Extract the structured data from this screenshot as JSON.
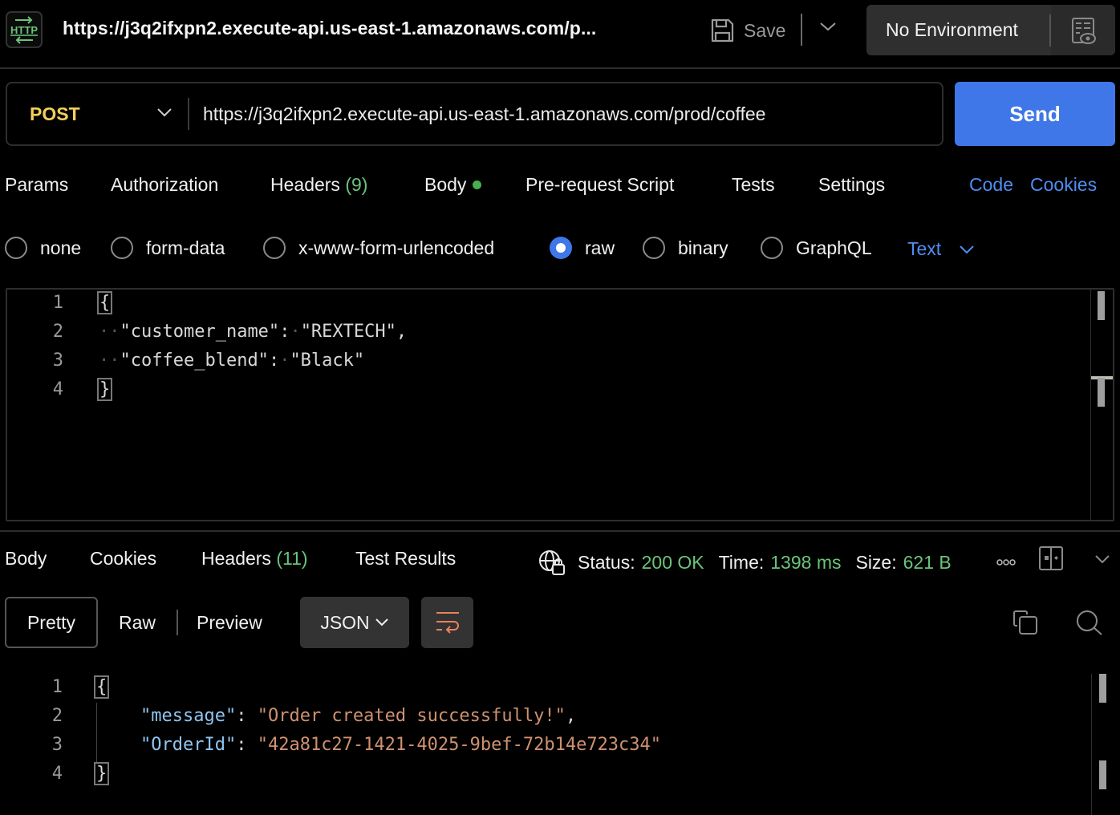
{
  "topbar": {
    "badge_label": "HTTP",
    "title": "https://j3q2ifxpn2.execute-api.us-east-1.amazonaws.com/p...",
    "save_label": "Save",
    "environment": "No Environment",
    "accent_green": "#6ac47a"
  },
  "request": {
    "method": "POST",
    "method_color": "#f2cf5c",
    "url": "https://j3q2ifxpn2.execute-api.us-east-1.amazonaws.com/prod/coffee",
    "send_label": "Send",
    "send_color": "#3f77e8"
  },
  "request_tabs": {
    "params": "Params",
    "authorization": "Authorization",
    "headers": "Headers",
    "headers_count": "(9)",
    "body": "Body",
    "pre_request": "Pre-request Script",
    "tests": "Tests",
    "settings": "Settings",
    "code": "Code",
    "cookies": "Cookies"
  },
  "body_types": {
    "options": [
      "none",
      "form-data",
      "x-www-form-urlencoded",
      "raw",
      "binary",
      "GraphQL"
    ],
    "selected": "raw",
    "format": "Text"
  },
  "request_body": {
    "line_numbers": [
      "1",
      "2",
      "3",
      "4"
    ],
    "lines": {
      "open": "{",
      "l2_key": "\"customer_name\"",
      "l2_sep": ":",
      "l2_val": "\"REXTECH\",",
      "l3_key": "\"coffee_blend\"",
      "l3_sep": ":",
      "l3_val": "\"Black\"",
      "close": "}"
    }
  },
  "response_tabs": {
    "body": "Body",
    "cookies": "Cookies",
    "headers": "Headers",
    "headers_count": "(11)",
    "test_results": "Test Results"
  },
  "response_status": {
    "status_label": "Status:",
    "status_value": "200 OK",
    "time_label": "Time:",
    "time_value": "1398 ms",
    "size_label": "Size:",
    "size_value": "621 B"
  },
  "response_view": {
    "pretty": "Pretty",
    "raw": "Raw",
    "preview": "Preview",
    "format": "JSON"
  },
  "response_body": {
    "line_numbers": [
      "1",
      "2",
      "3",
      "4"
    ],
    "open": "{",
    "l2_key": "\"message\"",
    "l2_val": "\"Order created successfully!\"",
    "l3_key": "\"OrderId\"",
    "l3_val": "\"42a81c27-1421-4025-9bef-72b14e723c34\"",
    "close": "}",
    "key_color": "#8fc6f2",
    "string_color": "#cf9170"
  }
}
